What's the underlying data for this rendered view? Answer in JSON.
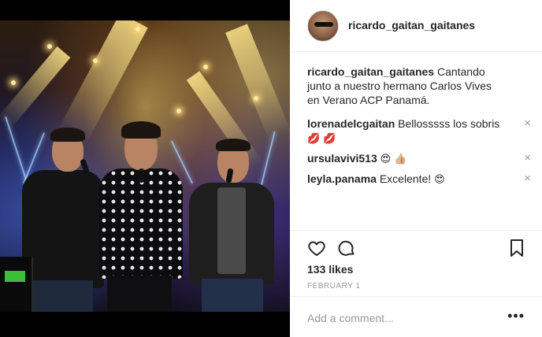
{
  "post": {
    "username": "ricardo_gaitan_gaitanes",
    "caption_text": "Cantando junto a nuestro hermano Carlos Vives en Verano ACP Panamá.",
    "likes": "133 likes",
    "date": "FEBRUARY 1",
    "image_alt": "Three singers on stage at a concert"
  },
  "comments": [
    {
      "user": "lorenadelcgaitan",
      "text": "Bellosssss los sobris",
      "emoji": "💋 💋"
    },
    {
      "user": "ursulavivi513",
      "text": "",
      "emoji": "😍 👍🏼"
    },
    {
      "user": "leyla.panama",
      "text": "Excelente!",
      "emoji": "😍"
    }
  ],
  "actions": {
    "like_icon": "heart-icon",
    "comment_icon": "comment-icon",
    "save_icon": "bookmark-icon"
  },
  "composer": {
    "placeholder": "Add a comment...",
    "more_label": "•••"
  },
  "icons": {
    "remove_comment": "×"
  }
}
